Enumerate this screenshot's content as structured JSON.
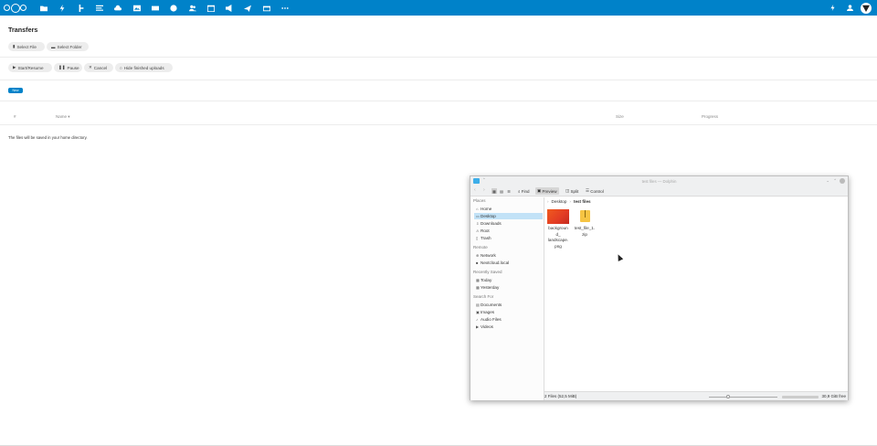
{
  "header": {
    "apps": [
      "files-icon",
      "activity-icon",
      "photos-icon",
      "notes-icon",
      "upload-icon",
      "gallery-icon",
      "mail-icon",
      "talk-icon",
      "contacts-icon",
      "calendar-icon",
      "announcements-icon",
      "forms-icon",
      "deck-icon",
      "more-icon"
    ],
    "right": [
      "notifications-icon",
      "contacts-menu-icon",
      "user-avatar"
    ]
  },
  "transfers": {
    "title": "Transfers",
    "select_file": "Select File",
    "select_folder": "Select Folder",
    "start_resume": "Start/Resume",
    "pause": "Pause",
    "cancel": "Cancel",
    "hide_finished": "Hide finished uploads",
    "new_badge": "New",
    "columns": {
      "num": "#",
      "name": "Name",
      "size": "Size",
      "progress": "Progress"
    },
    "note": "The files will be saved in your home directory."
  },
  "dolphin": {
    "title": "test files — Dolphin",
    "toolbar": {
      "find": "Find",
      "preview": "Preview",
      "split": "Split",
      "control": "Control"
    },
    "places_header": "Places",
    "places": [
      "Home",
      "Desktop",
      "Downloads",
      "Root",
      "Trash"
    ],
    "remote_header": "Remote",
    "remote": [
      "Network",
      "Nextcloud.local"
    ],
    "recent_header": "Recently Saved",
    "recent": [
      "Today",
      "Yesterday"
    ],
    "search_header": "Search For",
    "search": [
      "Documents",
      "Images",
      "Audio Files",
      "Videos"
    ],
    "breadcrumb": [
      "Desktop",
      "test files"
    ],
    "files": [
      {
        "name_lines": [
          "backgroun",
          "d_",
          "landscape.",
          "png"
        ],
        "type": "image"
      },
      {
        "name_lines": [
          "test_file_1.",
          "zip"
        ],
        "type": "archive"
      }
    ],
    "status_left": "2 Files (52,5 MiB)",
    "status_right": "30,9 GiB free"
  }
}
